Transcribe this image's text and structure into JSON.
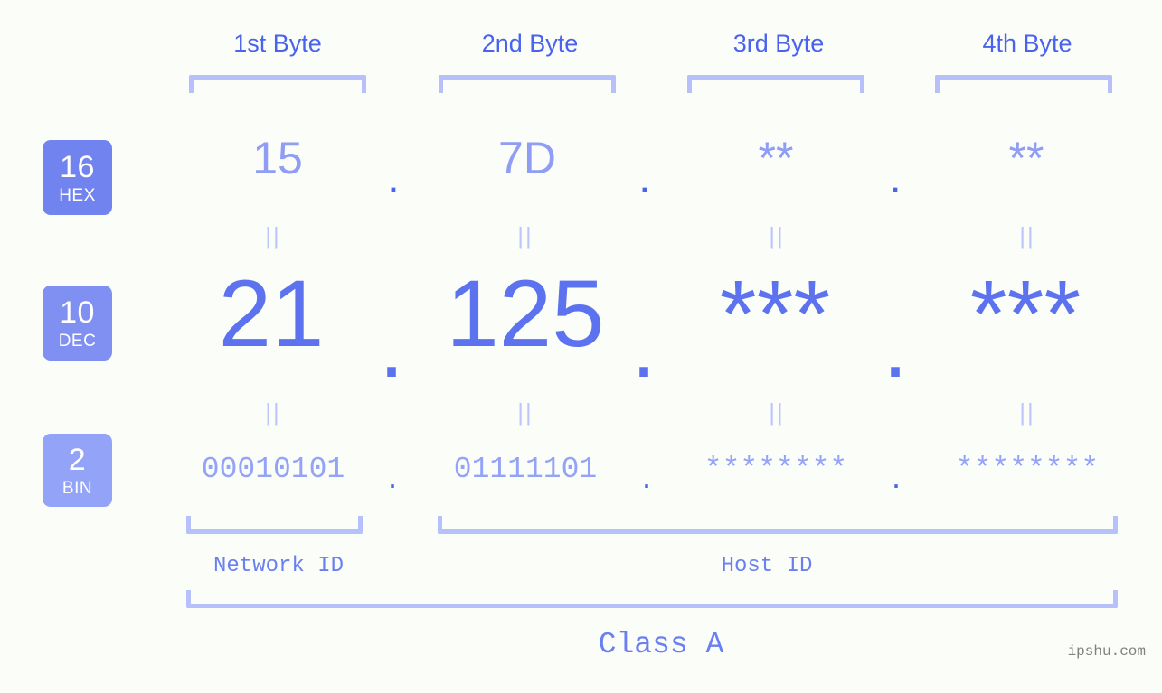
{
  "meta": {
    "background_color": "#fbfdf8",
    "accent_blue": "#4a63ee",
    "accent_light": "#b6c0fb",
    "watermark": "ipshu.com"
  },
  "byte_headers": [
    {
      "label": "1st Byte"
    },
    {
      "label": "2nd Byte"
    },
    {
      "label": "3rd Byte"
    },
    {
      "label": "4th Byte"
    }
  ],
  "bases": [
    {
      "id": "hex",
      "number": "16",
      "name": "HEX",
      "color": "#7183ef"
    },
    {
      "id": "dec",
      "number": "10",
      "name": "DEC",
      "color": "#7f8ff2"
    },
    {
      "id": "bin",
      "number": "2",
      "name": "BIN",
      "color": "#93a3f7"
    }
  ],
  "rows": {
    "hex": {
      "values": [
        "15",
        "7D",
        "**",
        "**"
      ],
      "separators": [
        ".",
        ".",
        "."
      ]
    },
    "dec": {
      "values": [
        "21",
        "125",
        "***",
        "***"
      ],
      "separators": [
        ".",
        ".",
        "."
      ]
    },
    "bin": {
      "values": [
        "00010101",
        "01111101",
        "********",
        "********"
      ],
      "separators": [
        ".",
        ".",
        "."
      ]
    }
  },
  "equals_separators": {
    "symbol": "||",
    "count_per_row": 4,
    "rows": 2
  },
  "sections": [
    {
      "id": "network",
      "label": "Network ID"
    },
    {
      "id": "host",
      "label": "Host ID"
    }
  ],
  "class_label": "Class A"
}
